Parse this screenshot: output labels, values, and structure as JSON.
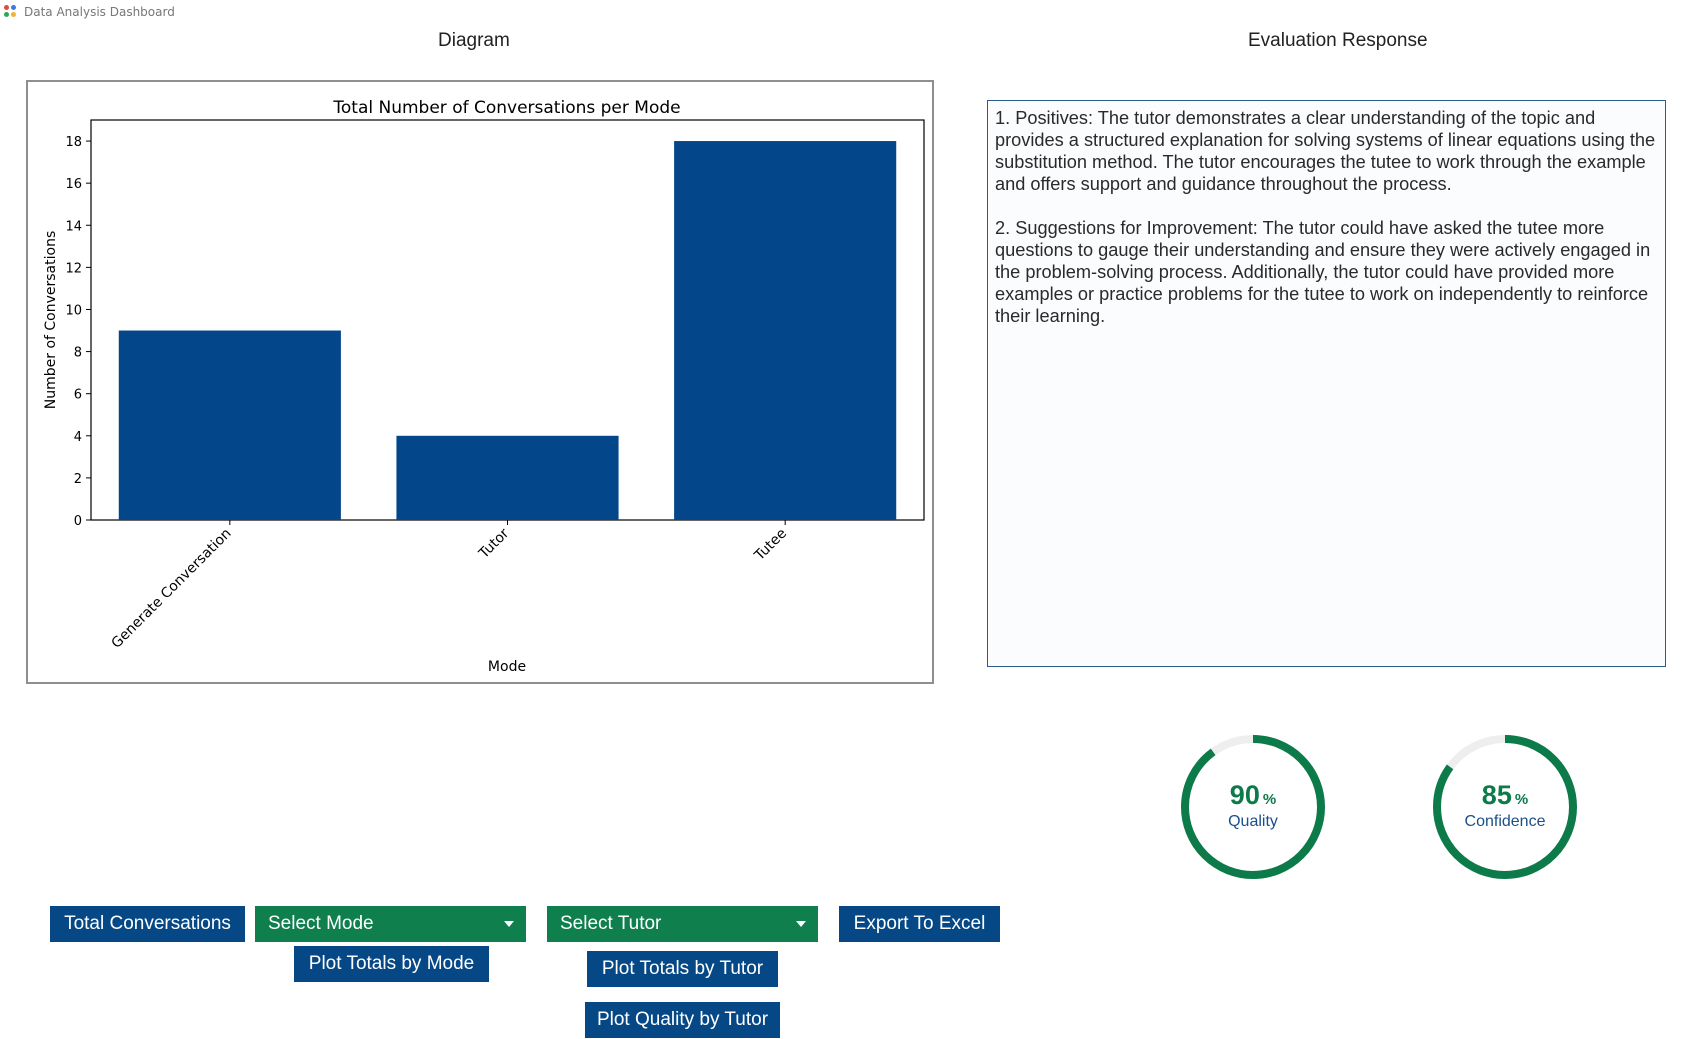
{
  "window": {
    "title": "Data Analysis Dashboard",
    "icon": "app-dots-icon"
  },
  "diagram_panel": {
    "heading": "Diagram"
  },
  "evaluation_panel": {
    "heading": "Evaluation Response",
    "text": "1. Positives: The tutor demonstrates a clear understanding of the topic and provides a structured explanation for solving systems of linear equations using the substitution method. The tutor encourages the tutee to work through the example and offers support and guidance throughout the process.\n\n2. Suggestions for Improvement: The tutor could have asked the tutee more questions to gauge their understanding and ensure they were actively engaged in the problem-solving process. Additionally, the tutor could have provided more examples or practice problems for the tutee to work on independently to reinforce their learning."
  },
  "chart_data": {
    "type": "bar",
    "title": "Total Number of Conversations per Mode",
    "xlabel": "Mode",
    "ylabel": "Number of Conversations",
    "categories": [
      "Generate Conversation",
      "Tutor",
      "Tutee"
    ],
    "values": [
      9,
      4,
      18
    ],
    "ylim": [
      0,
      19
    ],
    "yticks": [
      0,
      2,
      4,
      6,
      8,
      10,
      12,
      14,
      16,
      18
    ],
    "bar_color": "#03478a",
    "grid": false,
    "legend": "none"
  },
  "gauges": {
    "quality": {
      "value": 90,
      "unit": "%",
      "label": "Quality",
      "fraction": 0.9
    },
    "confidence": {
      "value": 85,
      "unit": "%",
      "label": "Confidence",
      "fraction": 0.85
    }
  },
  "colors": {
    "primary_blue": "#064785",
    "primary_green": "#0e7f4d",
    "gauge_green": "#0d7a4a",
    "gauge_track": "#eeeeee"
  },
  "controls": {
    "total_conversations_label": "Total Conversations",
    "select_mode": {
      "selected": "Select Mode"
    },
    "plot_totals_by_mode_label": "Plot Totals by Mode",
    "select_tutor": {
      "selected": "Select Tutor"
    },
    "plot_totals_by_tutor_label": "Plot Totals by Tutor",
    "plot_quality_by_tutor_label": "Plot Quality by Tutor",
    "export_label": "Export To Excel"
  }
}
